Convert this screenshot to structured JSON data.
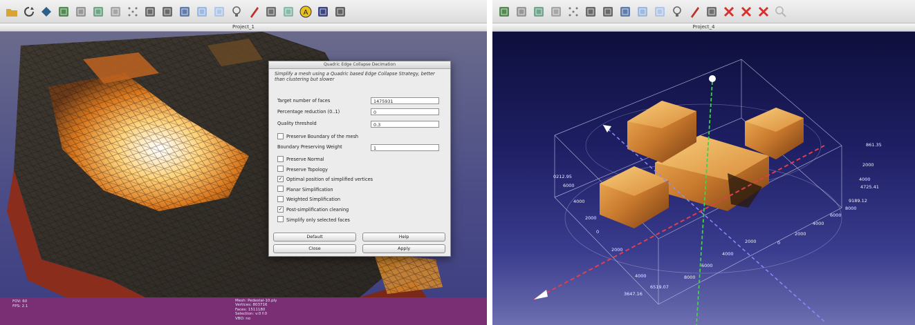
{
  "left_window": {
    "title": "Project_1",
    "toolbar_icons": [
      "open-folder-icon",
      "reload-icon",
      "eye-diamond-icon",
      "snapshot-icon",
      "layer-icon",
      "center-icon",
      "bbox-icon",
      "points-icon",
      "wireframe-icon",
      "hidden-lines-icon",
      "flat-icon",
      "smooth-icon",
      "texture-icon",
      "lightbulb-icon",
      "paint-brush-icon",
      "selection-icon",
      "pick-icon",
      "annotation-icon",
      "radiance-icon",
      "quality-icon"
    ],
    "info_left": [
      "FOV: 60",
      "FPS:  2.1"
    ],
    "info_right": [
      "Mesh: Pedestal-10.ply",
      "Vertices: 803716",
      "Faces: 1511180",
      "Selection: v:0 f:0",
      "VBO: no"
    ]
  },
  "dialog": {
    "title": "Quadric Edge Collapse Decimation",
    "description": "Simplify a mesh using a Quadric based Edge Collapse Strategy, better than clustering but slower",
    "fields": [
      {
        "label": "Target number of faces",
        "value": "1475931"
      },
      {
        "label": "Percentage reduction (0..1)",
        "value": "0"
      },
      {
        "label": "Quality threshold",
        "value": "0.3"
      }
    ],
    "preserve_boundary": {
      "label": "Preserve Boundary of the mesh",
      "checked": false
    },
    "boundary_weight": {
      "label": "Boundary Preserving Weight",
      "value": "1"
    },
    "checkboxes": [
      {
        "label": "Preserve Normal",
        "checked": false
      },
      {
        "label": "Preserve Topology",
        "checked": false
      },
      {
        "label": "Optimal position of simplified vertices",
        "checked": true
      },
      {
        "label": "Planar Simplification",
        "checked": false
      },
      {
        "label": "Weighted Simplification",
        "checked": false
      },
      {
        "label": "Post-simplification cleaning",
        "checked": true
      },
      {
        "label": "Simplify only selected faces",
        "checked": false
      }
    ],
    "buttons": {
      "default": "Default",
      "help": "Help",
      "close": "Close",
      "apply": "Apply"
    }
  },
  "right_window": {
    "title": "Project_4",
    "toolbar_icons": [
      "snapshot-icon",
      "layer-icon",
      "center-icon",
      "bbox-icon",
      "points-icon",
      "wireframe-icon",
      "hidden-lines-icon",
      "flat-icon",
      "smooth-icon",
      "texture-icon",
      "lightbulb-icon",
      "paint-brush-icon",
      "selection-icon",
      "cross-tool-icon",
      "cross-tool-icon",
      "cross-tool-icon",
      "zoom-icon"
    ],
    "axis_labels": [
      "861.35",
      "2000",
      "4000",
      "4725.41",
      "9189.12",
      "8000",
      "6000",
      "4000",
      "2000",
      "0",
      "2000",
      "4000",
      "6000",
      "8000",
      "0212.95",
      "6000",
      "4000",
      "2000",
      "0",
      "2000",
      "3647.16",
      "4000",
      "6519.07"
    ]
  },
  "colors": {
    "dialog_bg": "#ececec",
    "purple_band": "#7a2e74",
    "right_bg_top": "#0e0f3c",
    "right_bg_bottom": "#6d6fb0",
    "axis_red": "#e0404a",
    "axis_green": "#3fd24a",
    "axis_blue": "#8a8cff"
  }
}
